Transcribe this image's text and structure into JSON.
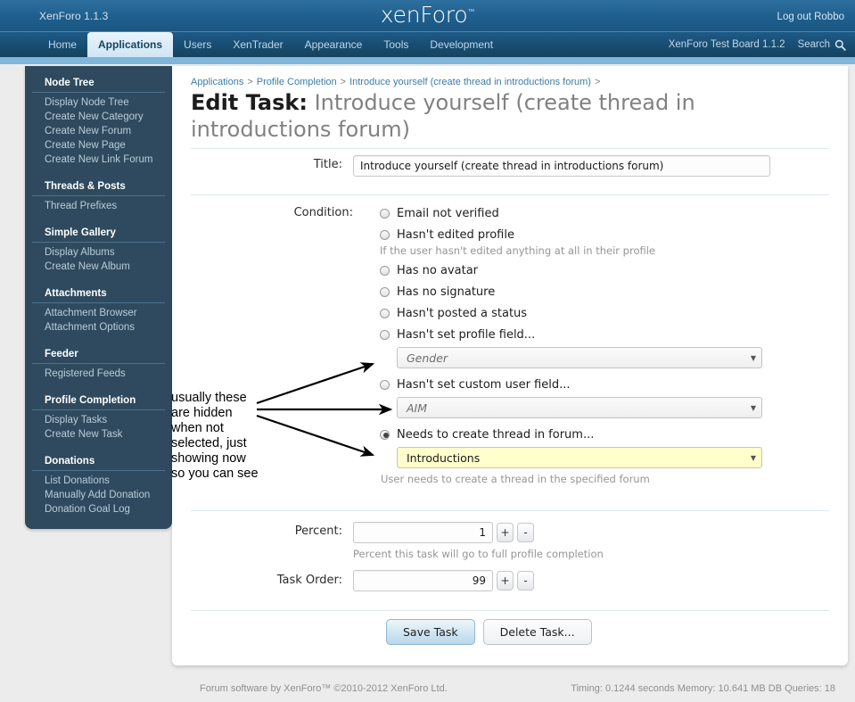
{
  "header": {
    "version": "XenForo 1.1.3",
    "logo": "xenForo",
    "logo_tm": "™",
    "logout": "Log out Robbo"
  },
  "nav": {
    "tabs": [
      {
        "label": "Home",
        "active": false
      },
      {
        "label": "Applications",
        "active": true
      },
      {
        "label": "Users",
        "active": false
      },
      {
        "label": "XenTrader",
        "active": false
      },
      {
        "label": "Appearance",
        "active": false
      },
      {
        "label": "Tools",
        "active": false
      },
      {
        "label": "Development",
        "active": false
      }
    ],
    "board_name": "XenForo Test Board 1.1.2",
    "search_label": "Search",
    "search_icon": "search-icon"
  },
  "sidebar": {
    "groups": [
      {
        "title": "Node Tree",
        "items": [
          "Display Node Tree",
          "Create New Category",
          "Create New Forum",
          "Create New Page",
          "Create New Link Forum"
        ]
      },
      {
        "title": "Threads & Posts",
        "items": [
          "Thread Prefixes"
        ]
      },
      {
        "title": "Simple Gallery",
        "items": [
          "Display Albums",
          "Create New Album"
        ]
      },
      {
        "title": "Attachments",
        "items": [
          "Attachment Browser",
          "Attachment Options"
        ]
      },
      {
        "title": "Feeder",
        "items": [
          "Registered Feeds"
        ]
      },
      {
        "title": "Profile Completion",
        "items": [
          "Display Tasks",
          "Create New Task"
        ]
      },
      {
        "title": "Donations",
        "items": [
          "List Donations",
          "Manually Add Donation",
          "Donation Goal Log"
        ]
      }
    ]
  },
  "breadcrumb": {
    "items": [
      "Applications",
      "Profile Completion",
      "Introduce yourself (create thread in introductions forum)"
    ],
    "separator": ">"
  },
  "page": {
    "title_prefix": "Edit Task:",
    "title_value": "Introduce yourself (create thread in introductions forum)"
  },
  "form": {
    "title_label": "Title:",
    "title_value": "Introduce yourself (create thread in introductions forum)",
    "condition_label": "Condition:",
    "conditions": [
      {
        "label": "Email not verified",
        "checked": false,
        "hint": null,
        "select": null
      },
      {
        "label": "Hasn't edited profile",
        "checked": false,
        "hint": "If the user hasn't edited anything at all in their profile",
        "select": null
      },
      {
        "label": "Has no avatar",
        "checked": false,
        "hint": null,
        "select": null
      },
      {
        "label": "Has no signature",
        "checked": false,
        "hint": null,
        "select": null
      },
      {
        "label": "Hasn't posted a status",
        "checked": false,
        "hint": null,
        "select": null
      },
      {
        "label": "Hasn't set profile field...",
        "checked": false,
        "hint": null,
        "select": {
          "value": "Gender",
          "highlighted": false
        }
      },
      {
        "label": "Hasn't set custom user field...",
        "checked": false,
        "hint": null,
        "select": {
          "value": "AIM",
          "highlighted": false
        }
      },
      {
        "label": "Needs to create thread in forum...",
        "checked": true,
        "hint": "User needs to create a thread in the specified forum",
        "select": {
          "value": "Introductions",
          "highlighted": true
        }
      }
    ],
    "percent_label": "Percent:",
    "percent_value": "1",
    "percent_hint": "Percent this task will go to full profile completion",
    "task_order_label": "Task Order:",
    "task_order_value": "99",
    "plus_label": "+",
    "minus_label": "-",
    "save_label": "Save Task",
    "delete_label": "Delete Task..."
  },
  "annotation": {
    "text": "usually these are hidden when not selected, just showing now so you can see"
  },
  "footer": {
    "left": "Forum software by XenForo™ ©2010-2012 XenForo Ltd.",
    "right": "Timing: 0.1244 seconds Memory: 10.641 MB DB Queries: 18"
  },
  "colors": {
    "header_blue": "#1f5f8d",
    "nav_dark": "#15425f",
    "sidebar": "#2f4a5e",
    "accent_link": "#3d7ca8",
    "highlight_field": "#ffffcc",
    "page_bg": "#ececec"
  }
}
